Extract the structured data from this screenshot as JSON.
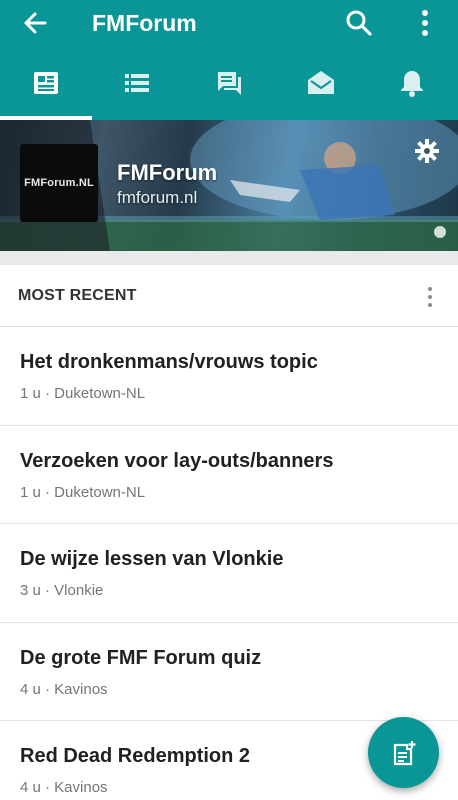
{
  "appbar": {
    "title": "FMForum",
    "back_icon": "arrow-back-icon",
    "search_icon": "search-icon",
    "more_icon": "more-vert-icon"
  },
  "tabs": [
    {
      "icon": "feed-icon",
      "active": true
    },
    {
      "icon": "list-icon",
      "active": false
    },
    {
      "icon": "chat-icon",
      "active": false
    },
    {
      "icon": "inbox-icon",
      "active": false
    },
    {
      "icon": "notifications-icon",
      "active": false
    }
  ],
  "banner": {
    "logo_text": "FMForum.NL",
    "forum_name": "FMForum",
    "forum_url": "fmforum.nl",
    "settings_icon": "gear-icon"
  },
  "section": {
    "label": "MOST RECENT"
  },
  "topics": [
    {
      "title": "Het dronkenmans/vrouws topic",
      "meta": "1 u · Duketown-NL"
    },
    {
      "title": "Verzoeken voor lay-outs/banners",
      "meta": "1 u · Duketown-NL"
    },
    {
      "title": "De wijze lessen van Vlonkie",
      "meta": "3 u · Vlonkie"
    },
    {
      "title": "De grote FMF Forum quiz",
      "meta": "4 u · Kavinos"
    },
    {
      "title": "Red Dead Redemption 2",
      "meta": "4 u · Kavinos"
    }
  ],
  "fab": {
    "icon": "new-topic-icon"
  },
  "colors": {
    "primary": "#0a9596",
    "divider": "#e3e3e3",
    "title_text": "#212121",
    "meta_text": "#757575"
  }
}
